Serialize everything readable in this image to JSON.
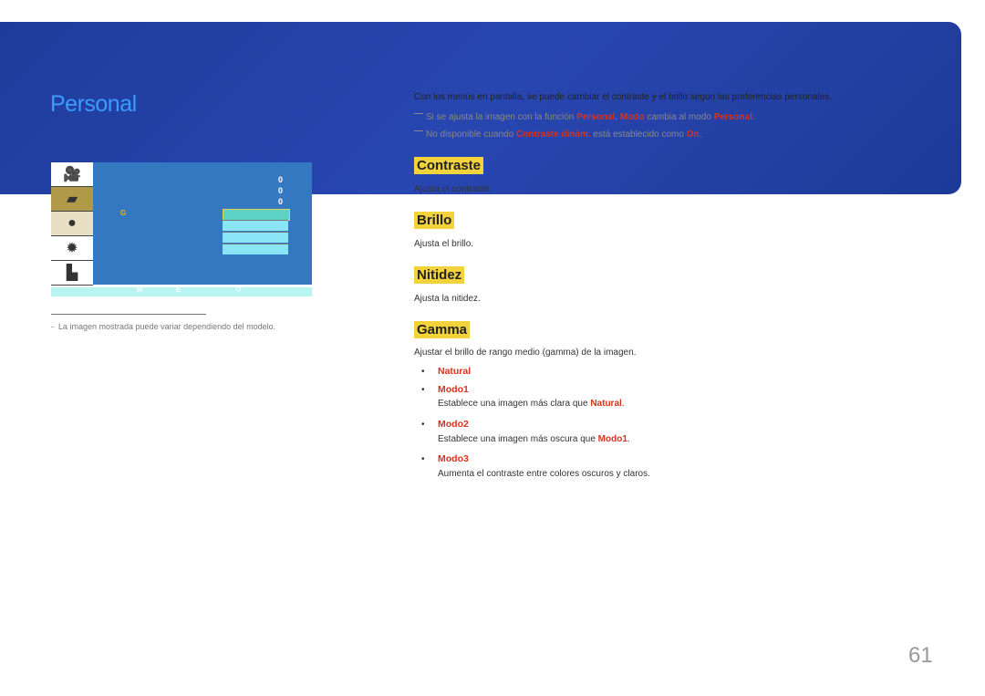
{
  "title": "Personal",
  "intro": "Con los menús en pantalla, se puede cambiar el contraste y el brillo según las preferencias personales.",
  "notes": [
    {
      "a": "Si se ajusta la imagen con la función ",
      "b": "Personal",
      "c": ", ",
      "d": "Modo",
      "e": " cambia al modo ",
      "f": "Personal",
      "g": "."
    },
    {
      "a": "No disponible cuando ",
      "b": "Contraste dinám.",
      "c": " está establecido como ",
      "d": "On",
      "e": "."
    }
  ],
  "sections": [
    {
      "heading": "Contraste",
      "text": "Ajusta el contraste."
    },
    {
      "heading": "Brillo",
      "text": "Ajusta el brillo."
    },
    {
      "heading": "Nitidez",
      "text": "Ajusta la nitidez."
    },
    {
      "heading": "Gamma",
      "text": "Ajustar el brillo de rango medio (gamma) de la imagen."
    }
  ],
  "gamma_options": [
    {
      "label": "Natural",
      "desc": ""
    },
    {
      "label": "Modo1",
      "desc_a": "Establece una imagen más clara que ",
      "desc_b": "Natural",
      "desc_c": "."
    },
    {
      "label": "Modo2",
      "desc_a": "Establece una imagen más oscura que ",
      "desc_b": "Modo1",
      "desc_c": "."
    },
    {
      "label": "Modo3",
      "desc_a": "Aumenta el contraste entre colores oscuros y claros.",
      "desc_b": "",
      "desc_c": ""
    }
  ],
  "osd": {
    "values": [
      "0",
      "0",
      "0"
    ],
    "gamma_letter": "G",
    "nav": [
      "M",
      "E"
    ]
  },
  "footnote": "La imagen mostrada puede variar dependiendo del modelo.",
  "page_number": "61",
  "colors": {
    "banner": "#2846b0",
    "title": "#3c9bff",
    "highlight": "#f2d33c",
    "accent": "#d8321b"
  }
}
